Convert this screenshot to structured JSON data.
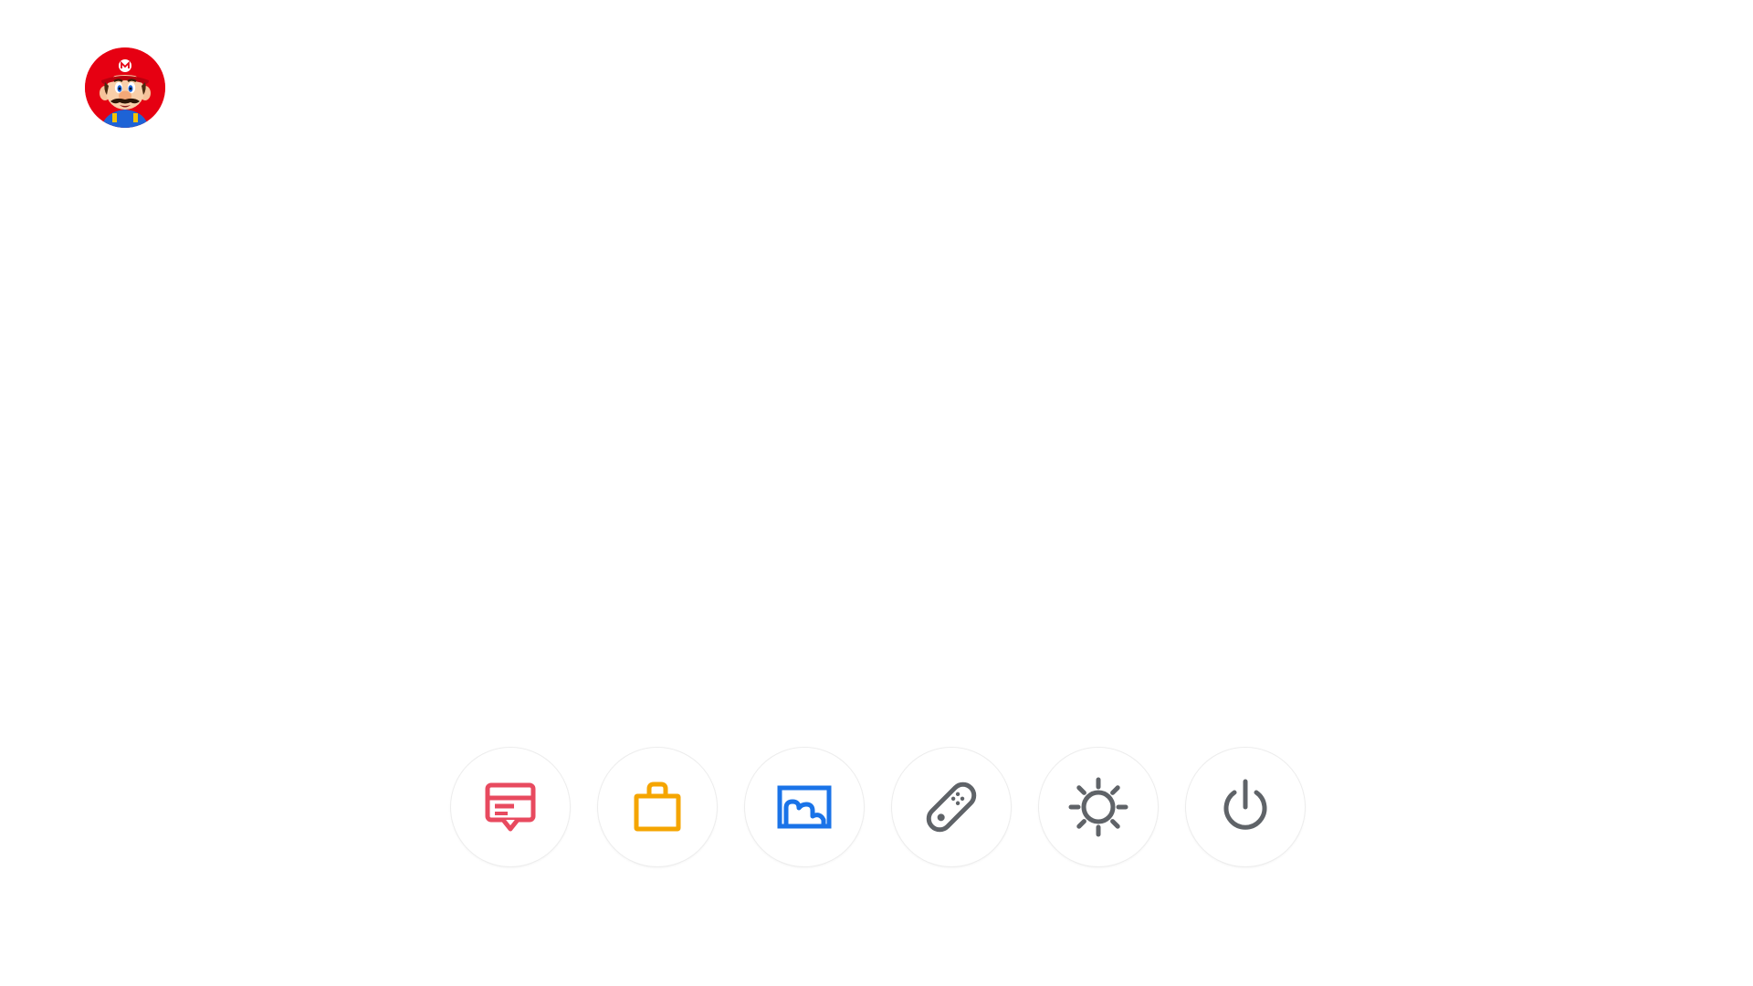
{
  "user": {
    "avatar_icon": "mario-avatar-icon",
    "avatar_bg_color": "#e60012"
  },
  "dock": {
    "buttons": [
      {
        "id": "news",
        "icon": "news-icon",
        "color": "#e84a5f"
      },
      {
        "id": "shop",
        "icon": "shopping-bag-icon",
        "color": "#f5a500"
      },
      {
        "id": "album",
        "icon": "album-icon",
        "color": "#1a73e8"
      },
      {
        "id": "controllers",
        "icon": "controller-icon",
        "color": "#5f6368"
      },
      {
        "id": "settings",
        "icon": "gear-icon",
        "color": "#5f6368"
      },
      {
        "id": "power",
        "icon": "power-icon",
        "color": "#5f6368"
      }
    ]
  }
}
